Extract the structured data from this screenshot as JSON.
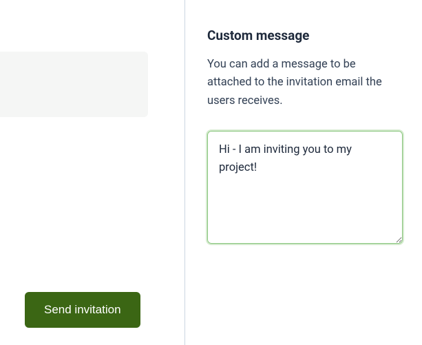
{
  "left": {
    "send_button_label": "Send invitation"
  },
  "right": {
    "title": "Custom message",
    "description": "You can add a message to be attached to the invitation email the users receives.",
    "message_value": "Hi - I am inviting you to my project!"
  }
}
